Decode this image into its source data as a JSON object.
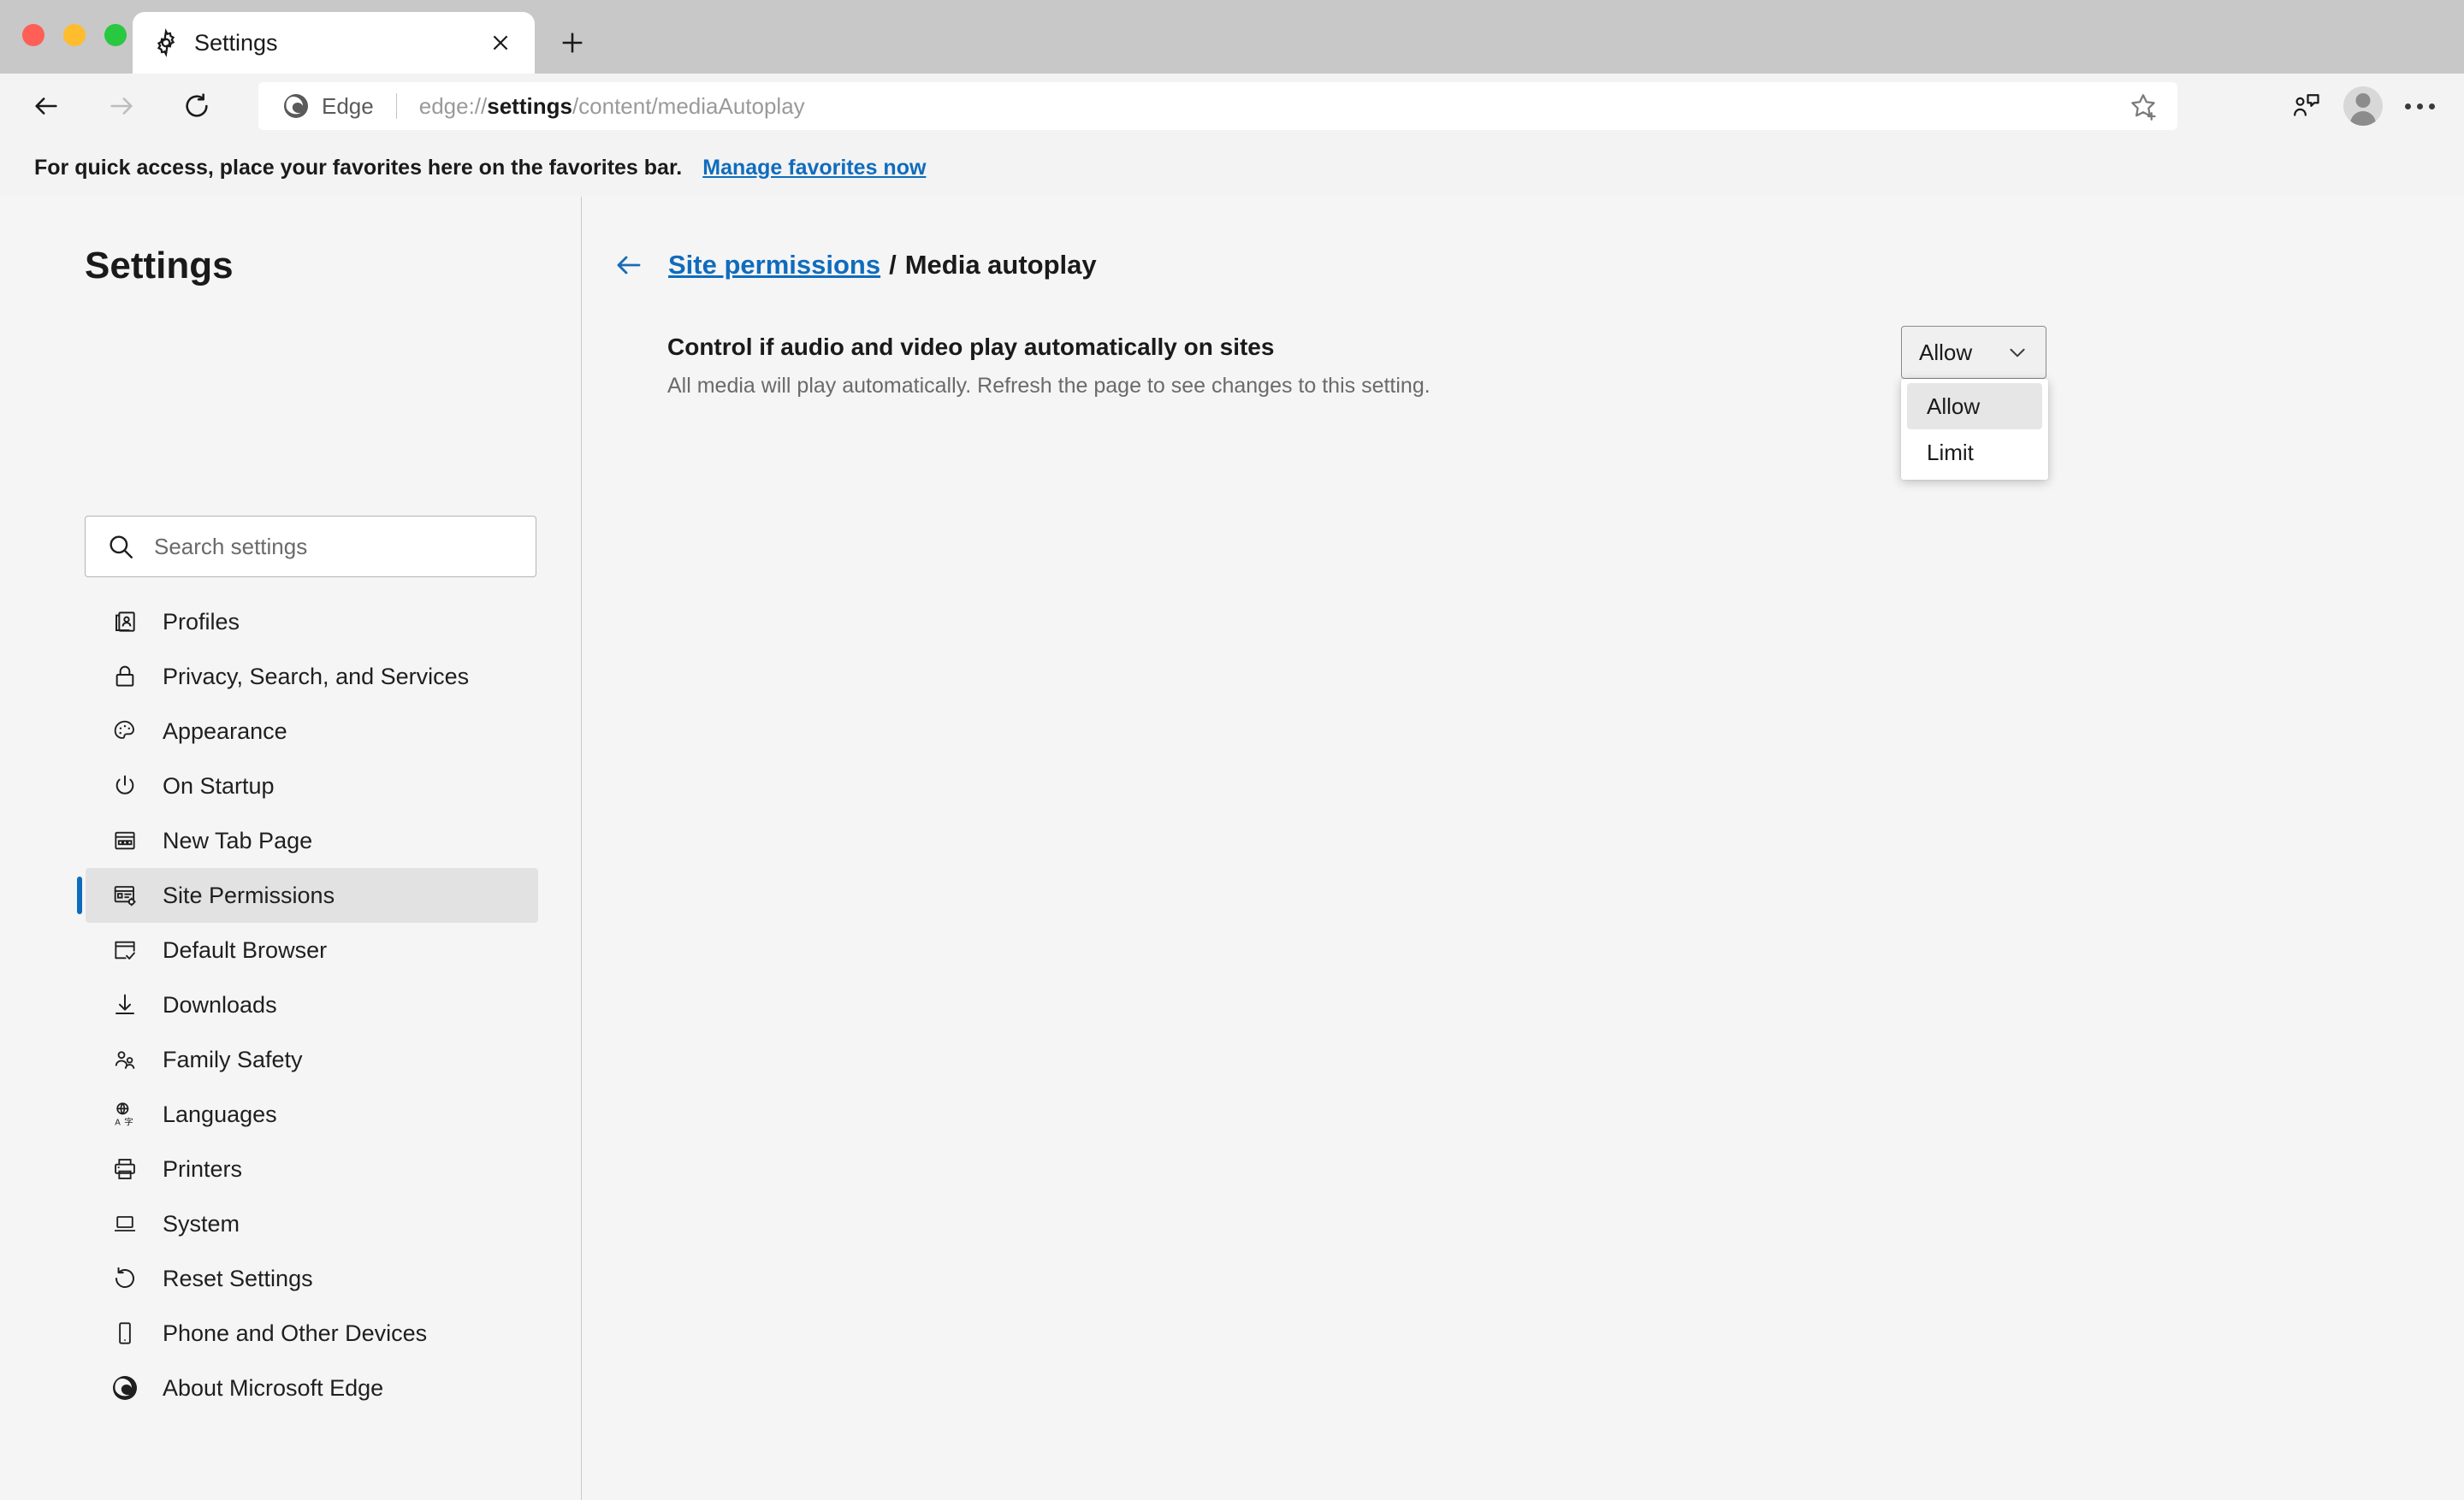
{
  "window": {
    "traffic_lights": [
      "close",
      "minimize",
      "maximize"
    ],
    "tab": {
      "title": "Settings",
      "favicon": "gear-icon",
      "close_label": "×"
    },
    "new_tab_label": "+"
  },
  "toolbar": {
    "back_label": "back",
    "forward_label": "forward",
    "reload_label": "reload",
    "brand_label": "Edge",
    "url_prefix": "edge://",
    "url_bold": "settings",
    "url_suffix": "/content/mediaAutoplay",
    "favorite_icon": "star-add-icon",
    "collections_icon": "collections-icon",
    "profile_icon": "avatar-icon",
    "more_icon": "more-ellipsis-icon"
  },
  "favorites_bar": {
    "message": "For quick access, place your favorites here on the favorites bar.",
    "link": "Manage favorites now"
  },
  "sidebar": {
    "title": "Settings",
    "search": {
      "placeholder": "Search settings",
      "value": "",
      "icon": "search-icon"
    },
    "items": [
      {
        "label": "Profiles",
        "icon": "profiles-icon",
        "active": false
      },
      {
        "label": "Privacy, Search, and Services",
        "icon": "lock-icon",
        "active": false
      },
      {
        "label": "Appearance",
        "icon": "palette-icon",
        "active": false
      },
      {
        "label": "On Startup",
        "icon": "power-icon",
        "active": false
      },
      {
        "label": "New Tab Page",
        "icon": "new-tab-page-icon",
        "active": false
      },
      {
        "label": "Site Permissions",
        "icon": "site-permissions-icon",
        "active": true
      },
      {
        "label": "Default Browser",
        "icon": "default-browser-icon",
        "active": false
      },
      {
        "label": "Downloads",
        "icon": "download-icon",
        "active": false
      },
      {
        "label": "Family Safety",
        "icon": "family-icon",
        "active": false
      },
      {
        "label": "Languages",
        "icon": "languages-icon",
        "active": false
      },
      {
        "label": "Printers",
        "icon": "printer-icon",
        "active": false
      },
      {
        "label": "System",
        "icon": "laptop-icon",
        "active": false
      },
      {
        "label": "Reset Settings",
        "icon": "reset-icon",
        "active": false
      },
      {
        "label": "Phone and Other Devices",
        "icon": "phone-icon",
        "active": false
      },
      {
        "label": "About Microsoft Edge",
        "icon": "edge-logo-icon",
        "active": false
      }
    ]
  },
  "content": {
    "breadcrumb": {
      "back_icon": "arrow-left-icon",
      "parent": "Site permissions",
      "separator": "/",
      "current": "Media autoplay"
    },
    "setting": {
      "title": "Control if audio and video play automatically on sites",
      "description": "All media will play automatically. Refresh the page to see changes to this setting.",
      "dropdown": {
        "value": "Allow",
        "chevron_icon": "chevron-down-icon",
        "expanded": true,
        "options": [
          {
            "label": "Allow",
            "selected": true
          },
          {
            "label": "Limit",
            "selected": false
          }
        ]
      }
    }
  },
  "colors": {
    "accent_blue": "#0f6cbd",
    "tabstrip": "#c8c8c8",
    "toolbar": "#f3f3f3",
    "page_bg": "#f5f5f5",
    "active_nav_bg": "#e2e2e2",
    "divider": "#c9c9c9"
  }
}
